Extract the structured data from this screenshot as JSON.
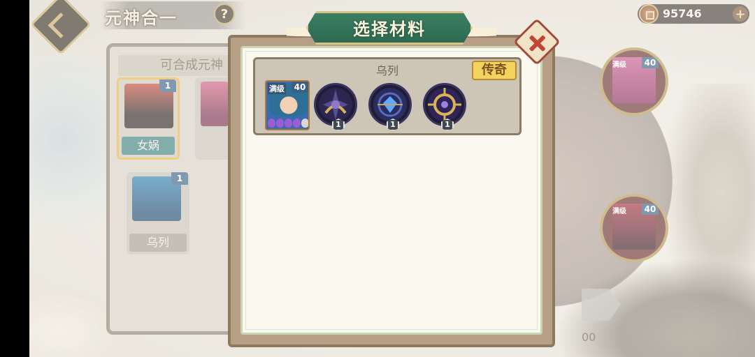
{
  "header": {
    "title": "元神合一",
    "help_label": "?",
    "currency_value": "95746",
    "currency_plus": "+"
  },
  "left_panel": {
    "title": "可合成元神",
    "cards": [
      {
        "name": "女娲",
        "level": "1",
        "selected": true
      },
      {
        "name": "乌列",
        "level": "1",
        "selected": false
      }
    ]
  },
  "side_heroes": [
    {
      "tag": "满级",
      "level": "40"
    },
    {
      "tag": "满级",
      "level": "40"
    }
  ],
  "background": {
    "cost_text": "00"
  },
  "modal": {
    "title": "选择材料",
    "group": {
      "name": "乌列",
      "rarity": "传奇",
      "hero": {
        "tag": "满级",
        "level": "40",
        "purple_flames": 4,
        "grey_flames": 1
      },
      "items": [
        {
          "icon": "dark-sword-emblem-icon",
          "count": "1"
        },
        {
          "icon": "blue-gem-emblem-icon",
          "count": "1"
        },
        {
          "icon": "gold-ring-emblem-icon",
          "count": "1"
        }
      ]
    }
  },
  "colors": {
    "modal_banner": "#2c6a51",
    "rarity_gold": "#f3d35e",
    "selected_border": "#e9b13a",
    "level_badge": "#3a5f86"
  }
}
